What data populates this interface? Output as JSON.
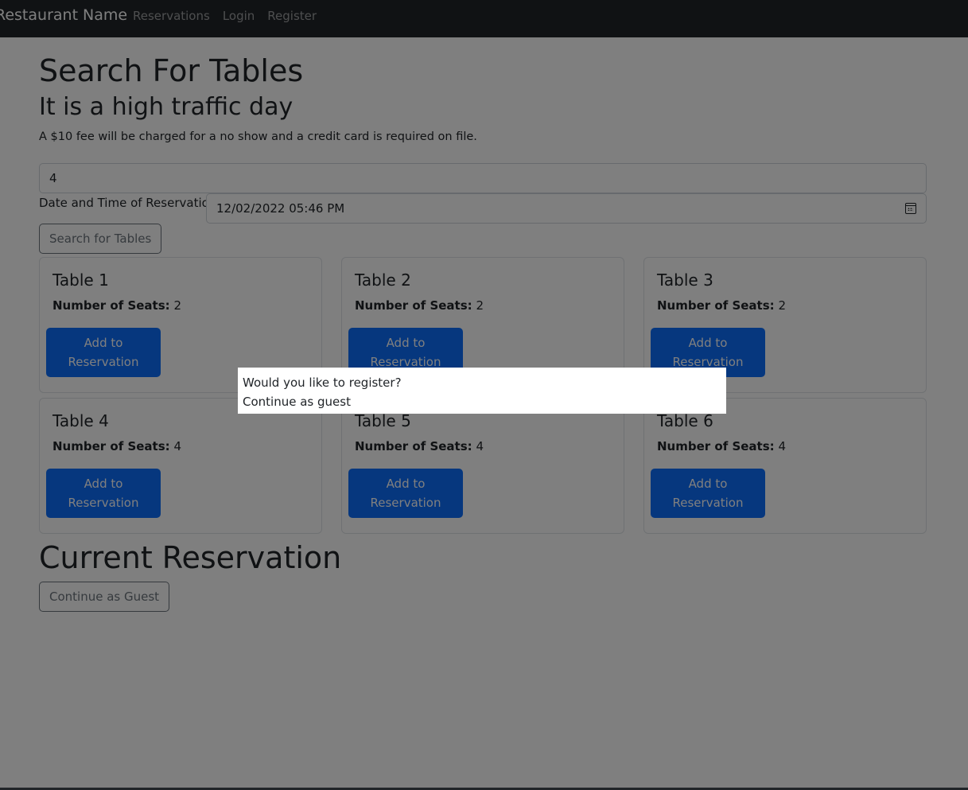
{
  "nav": {
    "brand": "Restaurant Name",
    "links": [
      "Reservations",
      "Login",
      "Register"
    ]
  },
  "main": {
    "title": "Search For Tables",
    "subtitle": "It is a high traffic day",
    "fee_notice": "A $10 fee will be charged for a no show and a credit card is required on file.",
    "guests_value": "4",
    "date_label": "Date and Time of Reservation:",
    "date_value": "12/02/2022 05:46 PM",
    "search_button": "Search for Tables",
    "seats_label": "Number of Seats:",
    "add_button_line1": "Add to",
    "add_button_line2": "Reservation",
    "tables": [
      {
        "name": "Table 1",
        "seats": "2"
      },
      {
        "name": "Table 2",
        "seats": "2"
      },
      {
        "name": "Table 3",
        "seats": "2"
      },
      {
        "name": "Table 4",
        "seats": "4"
      },
      {
        "name": "Table 5",
        "seats": "4"
      },
      {
        "name": "Table 6",
        "seats": "4"
      }
    ],
    "current_heading": "Current Reservation",
    "guest_button": "Continue as Guest"
  },
  "popup": {
    "register_option": "Would you like to register?",
    "guest_option": "Continue as guest"
  },
  "colors": {
    "navbar": "#212529",
    "primary": "#0d6efd",
    "overlay": "rgba(0,0,0,0.5)"
  }
}
